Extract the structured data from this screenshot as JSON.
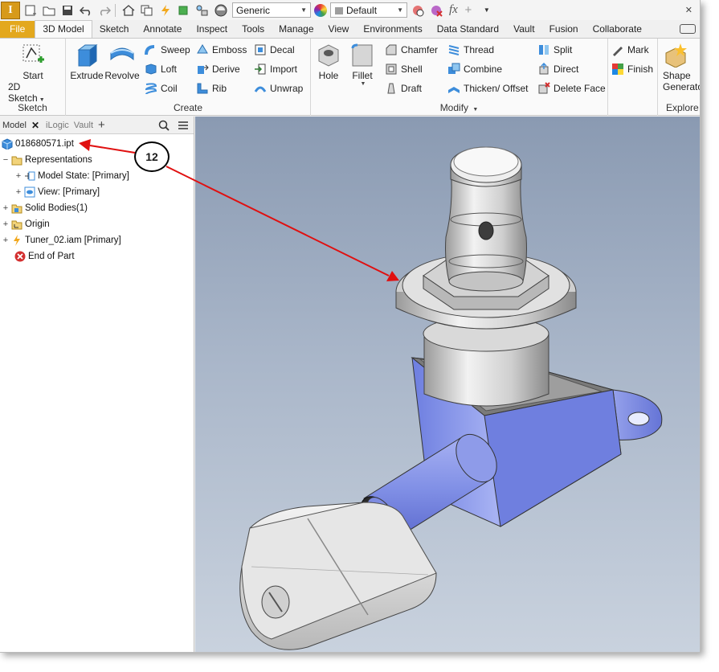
{
  "qat": {
    "app_letter": "I",
    "material_value": "Generic",
    "appearance_value": "Default",
    "fx_label": "fx"
  },
  "tabs": [
    {
      "label": "File"
    },
    {
      "label": "3D Model"
    },
    {
      "label": "Sketch"
    },
    {
      "label": "Annotate"
    },
    {
      "label": "Inspect"
    },
    {
      "label": "Tools"
    },
    {
      "label": "Manage"
    },
    {
      "label": "View"
    },
    {
      "label": "Environments"
    },
    {
      "label": "Data Standard"
    },
    {
      "label": "Vault"
    },
    {
      "label": "Fusion"
    },
    {
      "label": "Collaborate"
    }
  ],
  "ribbon": {
    "sketch": {
      "title": "Sketch",
      "start_line1": "Start",
      "start_line2": "2D Sketch"
    },
    "create": {
      "title": "Create",
      "extrude": "Extrude",
      "revolve": "Revolve",
      "sweep": "Sweep",
      "loft": "Loft",
      "coil": "Coil",
      "emboss": "Emboss",
      "derive": "Derive",
      "rib": "Rib",
      "decal": "Decal",
      "import": "Import",
      "unwrap": "Unwrap"
    },
    "modify": {
      "title": "Modify",
      "hole": "Hole",
      "fillet": "Fillet",
      "chamfer": "Chamfer",
      "shell": "Shell",
      "draft": "Draft",
      "thread": "Thread",
      "combine": "Combine",
      "thicken": "Thicken/ Offset",
      "split": "Split",
      "direct": "Direct",
      "delete_face": "Delete Face"
    },
    "mark": {
      "mark": "Mark",
      "finish": "Finish"
    },
    "explore": {
      "title": "Explore",
      "shape_line1": "Shape",
      "shape_line2": "Generator"
    }
  },
  "browser": {
    "tabs": [
      "Model",
      "iLogic",
      "Vault"
    ],
    "tree": [
      {
        "label": "018680571.ipt"
      },
      {
        "label": "Representations"
      },
      {
        "label": "Model State: [Primary]"
      },
      {
        "label": "View: [Primary]"
      },
      {
        "label": "Solid Bodies(1)"
      },
      {
        "label": "Origin"
      },
      {
        "label": "Tuner_02.iam [Primary]"
      },
      {
        "label": "End of Part"
      }
    ]
  },
  "callout": {
    "number": "12"
  },
  "colors": {
    "file_tab": "#e3a81e",
    "app_button": "#d79a1a",
    "callout_arrow": "#e01010",
    "part_blue": "#7f8fe8"
  }
}
